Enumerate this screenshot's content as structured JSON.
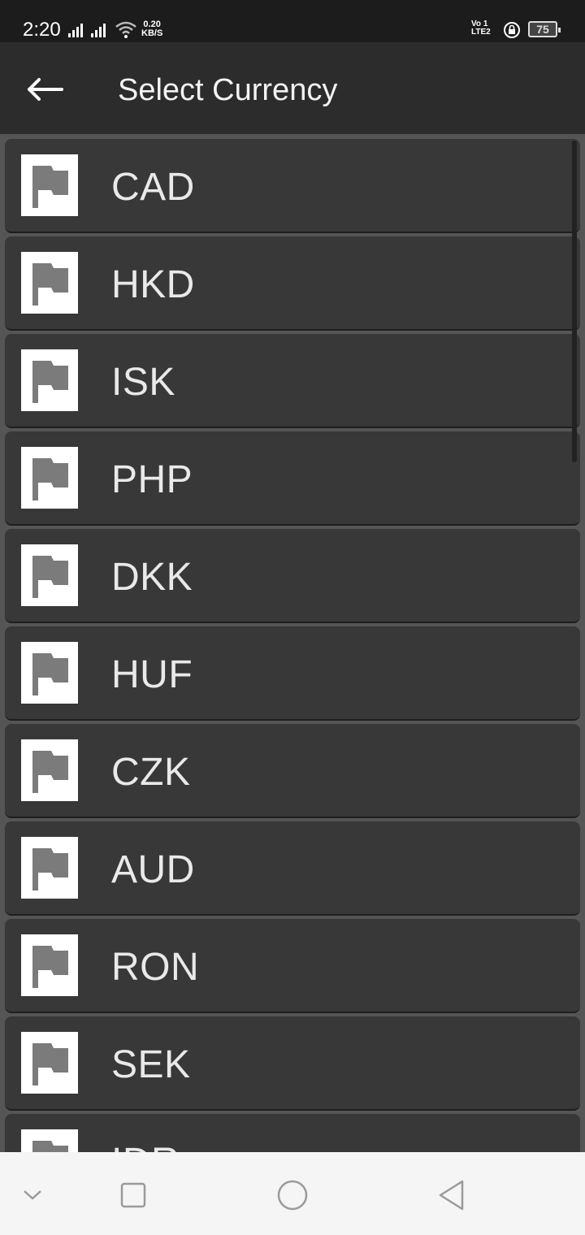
{
  "status_bar": {
    "time": "2:20",
    "net_speed_value": "0.20",
    "net_speed_unit": "KB/S",
    "volte_top": "Vo 1",
    "volte_bottom": "LTE2",
    "battery": "75"
  },
  "app_bar": {
    "title": "Select Currency",
    "back_icon": "arrow-left-icon"
  },
  "currencies": [
    {
      "code": "CAD",
      "icon": "flag-icon"
    },
    {
      "code": "HKD",
      "icon": "flag-icon"
    },
    {
      "code": "ISK",
      "icon": "flag-icon"
    },
    {
      "code": "PHP",
      "icon": "flag-icon"
    },
    {
      "code": "DKK",
      "icon": "flag-icon"
    },
    {
      "code": "HUF",
      "icon": "flag-icon"
    },
    {
      "code": "CZK",
      "icon": "flag-icon"
    },
    {
      "code": "AUD",
      "icon": "flag-icon"
    },
    {
      "code": "RON",
      "icon": "flag-icon"
    },
    {
      "code": "SEK",
      "icon": "flag-icon"
    },
    {
      "code": "IDR",
      "icon": "flag-icon"
    }
  ],
  "nav_bar": {
    "icons": [
      "chevron-down-icon",
      "square-icon",
      "circle-icon",
      "triangle-back-icon"
    ]
  },
  "colors": {
    "app_bar": "#2c2c2c",
    "status_bar": "#1c1c1c",
    "list_item": "#383838",
    "flag_grey": "#7b7b7b"
  }
}
